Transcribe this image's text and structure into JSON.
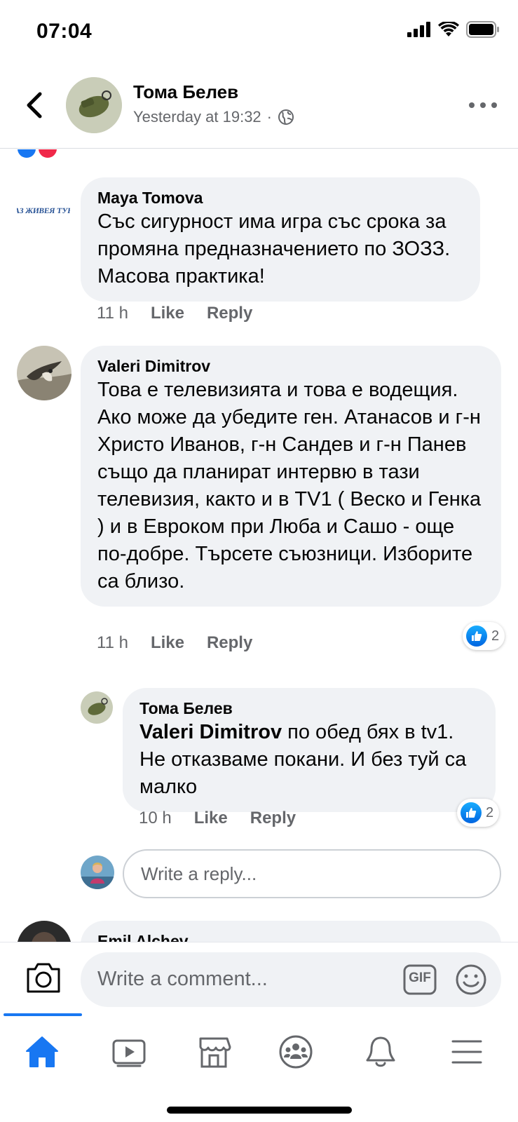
{
  "status_bar": {
    "time": "07:04"
  },
  "header": {
    "name": "Тома Белев",
    "timestamp": "Yesterday at 19:32",
    "separator": "·",
    "audience_icon": "globe-icon"
  },
  "comments": [
    {
      "author": "Maya Tomova",
      "avatar_text": "АЗ ЖИВЕЯ ТУК",
      "text": "Със сигурност има игра със срока за промяна предназначението по ЗОЗЗ. Масова практика!",
      "time": "11 h",
      "like_label": "Like",
      "reply_label": "Reply"
    },
    {
      "author": "Valeri Dimitrov",
      "text": "Това е телевизията и това е водещия. Ако може да убедите ген. Атанасов и г-н Христо Иванов, г-н Сандев и г-н Панев също да планират интервю в тази телевизия, както и в TV1 ( Веско и Генка )  и в Евроком при Люба и Сашо - още по-добре. Търсете съюзници. Изборите са близо.",
      "time": "11 h",
      "like_label": "Like",
      "reply_label": "Reply",
      "reaction_count": "2"
    }
  ],
  "reply": {
    "author": "Тома Белев",
    "mention": "Valeri Dimitrov",
    "text": " по обед бях в tv1. Не отказваме покани. И без туй са малко",
    "time": "10 h",
    "like_label": "Like",
    "reply_label": "Reply",
    "reaction_count": "2"
  },
  "reply_input": {
    "placeholder": "Write a reply..."
  },
  "next_comment": {
    "author": "Emil Alchev"
  },
  "comment_bar": {
    "placeholder": "Write a comment...",
    "gif_label": "GIF"
  },
  "tab_bar": {
    "tabs": [
      "home-icon",
      "watch-icon",
      "marketplace-icon",
      "groups-icon",
      "notifications-icon",
      "menu-icon"
    ],
    "active": "home-icon",
    "accent": "#1877f2"
  }
}
